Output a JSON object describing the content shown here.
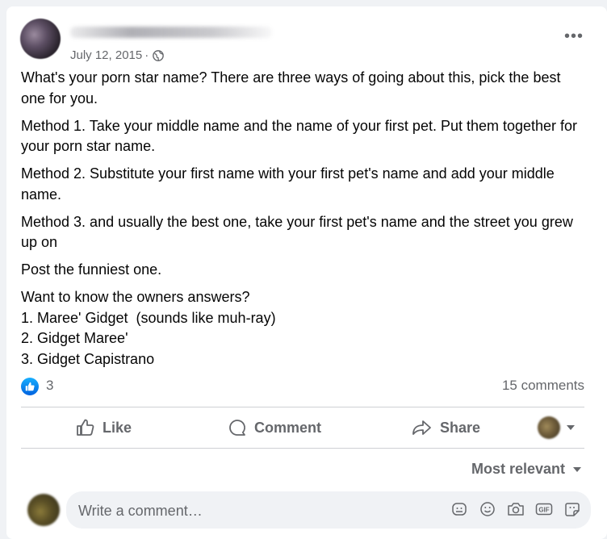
{
  "post": {
    "date": "July 12, 2015",
    "separator": "·",
    "more_label": "•••",
    "paragraphs": [
      "What's your porn star name? There are three ways of going about this, pick the best one for you.",
      "Method 1. Take your middle name and the name of your first pet. Put them together for your porn star name.",
      "Method 2. Substitute your first name with your first pet's name and add your middle name.",
      "Method 3. and usually the best one, take your first pet's name and the street you grew up on",
      "Post the funniest one."
    ],
    "answers_heading": "Want to know the owners answers?",
    "answers": [
      "1. Maree' Gidget  (sounds like muh-ray)",
      "2. Gidget Maree'",
      "3. Gidget Capistrano"
    ]
  },
  "reactions": {
    "count": "3",
    "comments": "15 comments"
  },
  "actions": {
    "like": "Like",
    "comment": "Comment",
    "share": "Share"
  },
  "comments": {
    "sort_label": "Most relevant",
    "placeholder": "Write a comment…"
  },
  "colors": {
    "accent": "#1877f2",
    "muted": "#65676b",
    "background": "#f0f2f5"
  }
}
